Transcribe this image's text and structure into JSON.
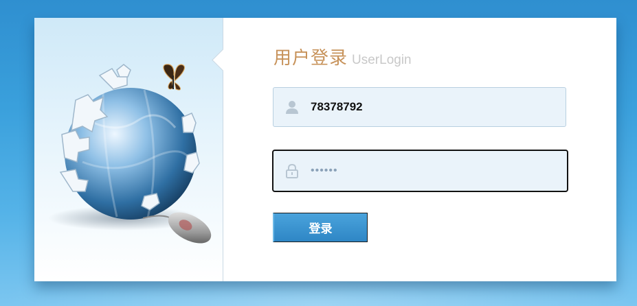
{
  "header": {
    "title_cn": "用户登录",
    "title_en": "UserLogin"
  },
  "form": {
    "username": {
      "value": "78378792",
      "icon": "user-icon"
    },
    "password": {
      "value": "••••••",
      "icon": "lock-icon"
    },
    "submit_label": "登录"
  },
  "illustration": {
    "items": [
      "puzzle-globe-image",
      "butterfly-image",
      "computer-mouse-image"
    ]
  },
  "colors": {
    "background": "#3aa0dc",
    "title_cn": "#c7925a",
    "title_en": "#c8c8c8",
    "field_bg": "#eaf3fa",
    "button": "#3a96d2"
  }
}
